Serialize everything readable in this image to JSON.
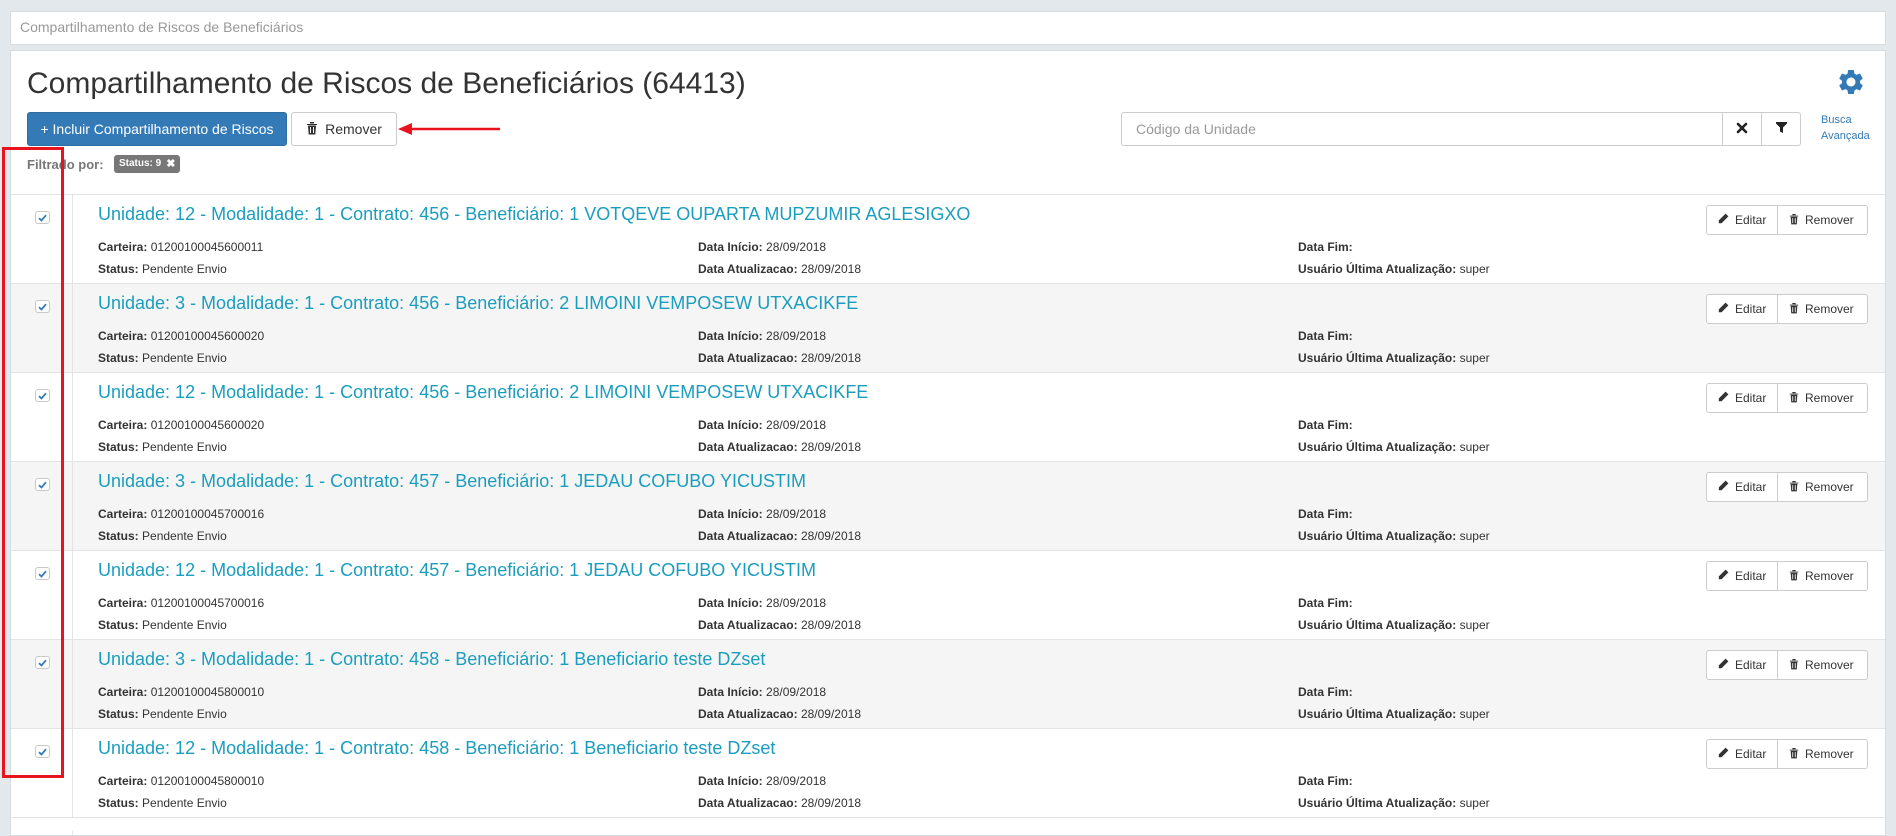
{
  "breadcrumb": {
    "text": "Compartilhamento de Riscos de Beneficiários"
  },
  "header": {
    "title": "Compartilhamento de Riscos de Beneficiários (64413)",
    "settings_icon": "gear-icon"
  },
  "toolbar": {
    "add_label": "+ Incluir Compartilhamento de Riscos",
    "remove_label": "Remover",
    "search_placeholder": "Código da Unidade",
    "search_value": "",
    "advanced_search_line1": "Busca",
    "advanced_search_line2": "Avançada"
  },
  "filter": {
    "label": "Filtrado por:",
    "badge": "Status: 9"
  },
  "labels": {
    "carteira": "Carteira:",
    "status": "Status:",
    "data_inicio": "Data Início:",
    "data_atualizacao": "Data Atualizacao:",
    "data_fim": "Data Fim:",
    "usuario": "Usuário Última Atualização:",
    "edit": "Editar",
    "remove": "Remover"
  },
  "colors": {
    "primary": "#337ab7",
    "link": "#1a9dbe",
    "annotation_red": "#e8131d"
  },
  "rows": [
    {
      "title": "Unidade: 12 - Modalidade: 1 - Contrato: 456 - Beneficiário: 1 VOTQEVE OUPARTA MUPZUMIR AGLESIGXO",
      "carteira": "01200100045600011",
      "status": "Pendente Envio",
      "data_inicio": "28/09/2018",
      "data_atualizacao": "28/09/2018",
      "data_fim": "",
      "usuario": "super",
      "checked": true
    },
    {
      "title": "Unidade: 3 - Modalidade: 1 - Contrato: 456 - Beneficiário: 2 LIMOINI VEMPOSEW UTXACIKFE",
      "carteira": "01200100045600020",
      "status": "Pendente Envio",
      "data_inicio": "28/09/2018",
      "data_atualizacao": "28/09/2018",
      "data_fim": "",
      "usuario": "super",
      "checked": true
    },
    {
      "title": "Unidade: 12 - Modalidade: 1 - Contrato: 456 - Beneficiário: 2 LIMOINI VEMPOSEW UTXACIKFE",
      "carteira": "01200100045600020",
      "status": "Pendente Envio",
      "data_inicio": "28/09/2018",
      "data_atualizacao": "28/09/2018",
      "data_fim": "",
      "usuario": "super",
      "checked": true
    },
    {
      "title": "Unidade: 3 - Modalidade: 1 - Contrato: 457 - Beneficiário: 1 JEDAU COFUBO YICUSTIM",
      "carteira": "01200100045700016",
      "status": "Pendente Envio",
      "data_inicio": "28/09/2018",
      "data_atualizacao": "28/09/2018",
      "data_fim": "",
      "usuario": "super",
      "checked": true
    },
    {
      "title": "Unidade: 12 - Modalidade: 1 - Contrato: 457 - Beneficiário: 1 JEDAU COFUBO YICUSTIM",
      "carteira": "01200100045700016",
      "status": "Pendente Envio",
      "data_inicio": "28/09/2018",
      "data_atualizacao": "28/09/2018",
      "data_fim": "",
      "usuario": "super",
      "checked": true
    },
    {
      "title": "Unidade: 3 - Modalidade: 1 - Contrato: 458 - Beneficiário: 1 Beneficiario teste DZset",
      "carteira": "01200100045800010",
      "status": "Pendente Envio",
      "data_inicio": "28/09/2018",
      "data_atualizacao": "28/09/2018",
      "data_fim": "",
      "usuario": "super",
      "checked": true
    },
    {
      "title": "Unidade: 12 - Modalidade: 1 - Contrato: 458 - Beneficiário: 1 Beneficiario teste DZset",
      "carteira": "01200100045800010",
      "status": "Pendente Envio",
      "data_inicio": "28/09/2018",
      "data_atualizacao": "28/09/2018",
      "data_fim": "",
      "usuario": "super",
      "checked": true
    }
  ]
}
